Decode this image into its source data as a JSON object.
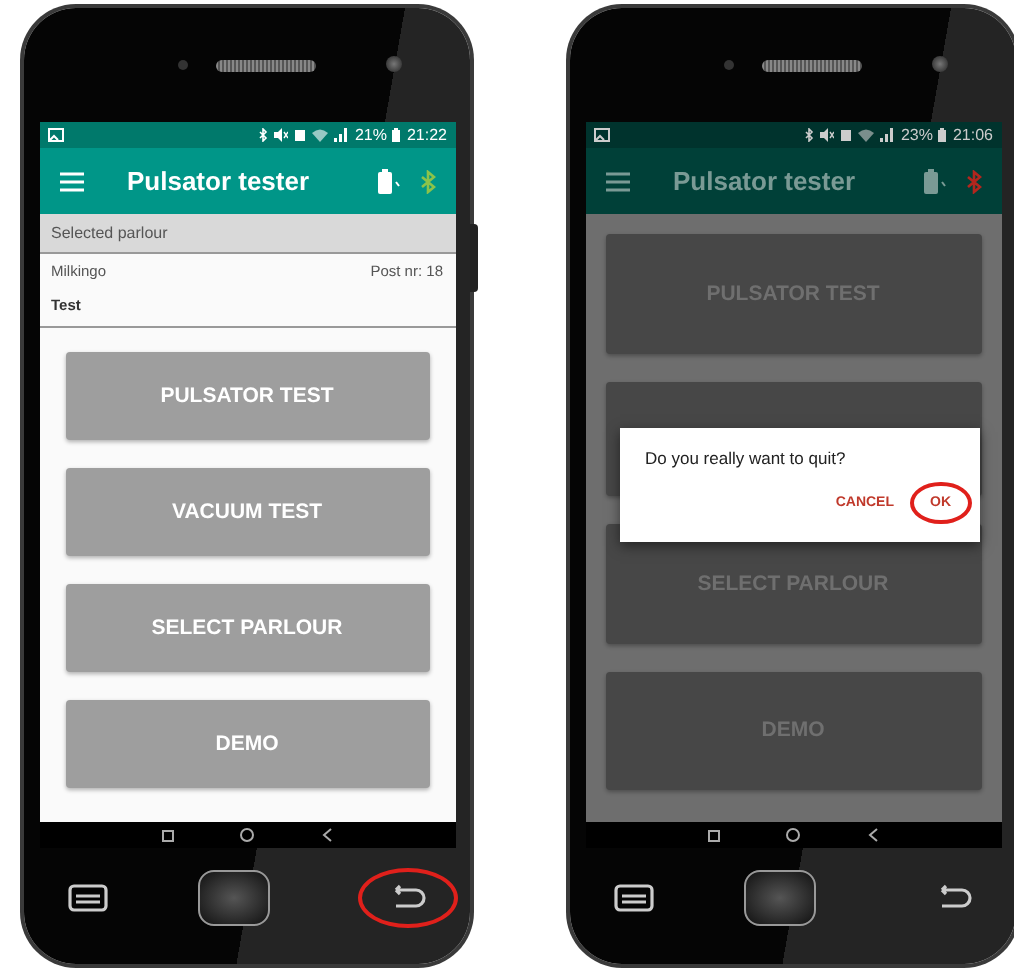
{
  "phones": [
    {
      "dimmed": false,
      "status_bar": {
        "battery": "21%",
        "time": "21:22"
      },
      "app_bar": {
        "title": "Pulsator tester",
        "bluetooth_connected": true
      },
      "section_header": "Selected parlour",
      "parlour": {
        "name": "Milkingo",
        "post": "Post nr: 18",
        "label": "Test"
      },
      "buttons": [
        {
          "kind": "plain",
          "label": "PULSATOR TEST"
        },
        {
          "kind": "plain",
          "label": "VACUUM TEST"
        },
        {
          "kind": "plain",
          "label": "SELECT PARLOUR"
        },
        {
          "kind": "plain",
          "label": "DEMO"
        }
      ],
      "back_key_highlighted": true
    },
    {
      "dimmed": true,
      "status_bar": {
        "battery": "23%",
        "time": "21:06"
      },
      "app_bar": {
        "title": "Pulsator tester",
        "bluetooth_connected": false
      },
      "buttons": [
        {
          "kind": "plain",
          "label": "PULSATOR TEST"
        },
        {
          "kind": "covered"
        },
        {
          "kind": "plain",
          "label": "SELECT PARLOUR"
        },
        {
          "kind": "plain",
          "label": "DEMO"
        }
      ],
      "dialog": {
        "message": "Do you really want to quit?",
        "actions": [
          {
            "label": "CANCEL",
            "highlighted": false
          },
          {
            "label": "OK",
            "highlighted": true
          }
        ]
      },
      "back_key_highlighted": false
    }
  ]
}
